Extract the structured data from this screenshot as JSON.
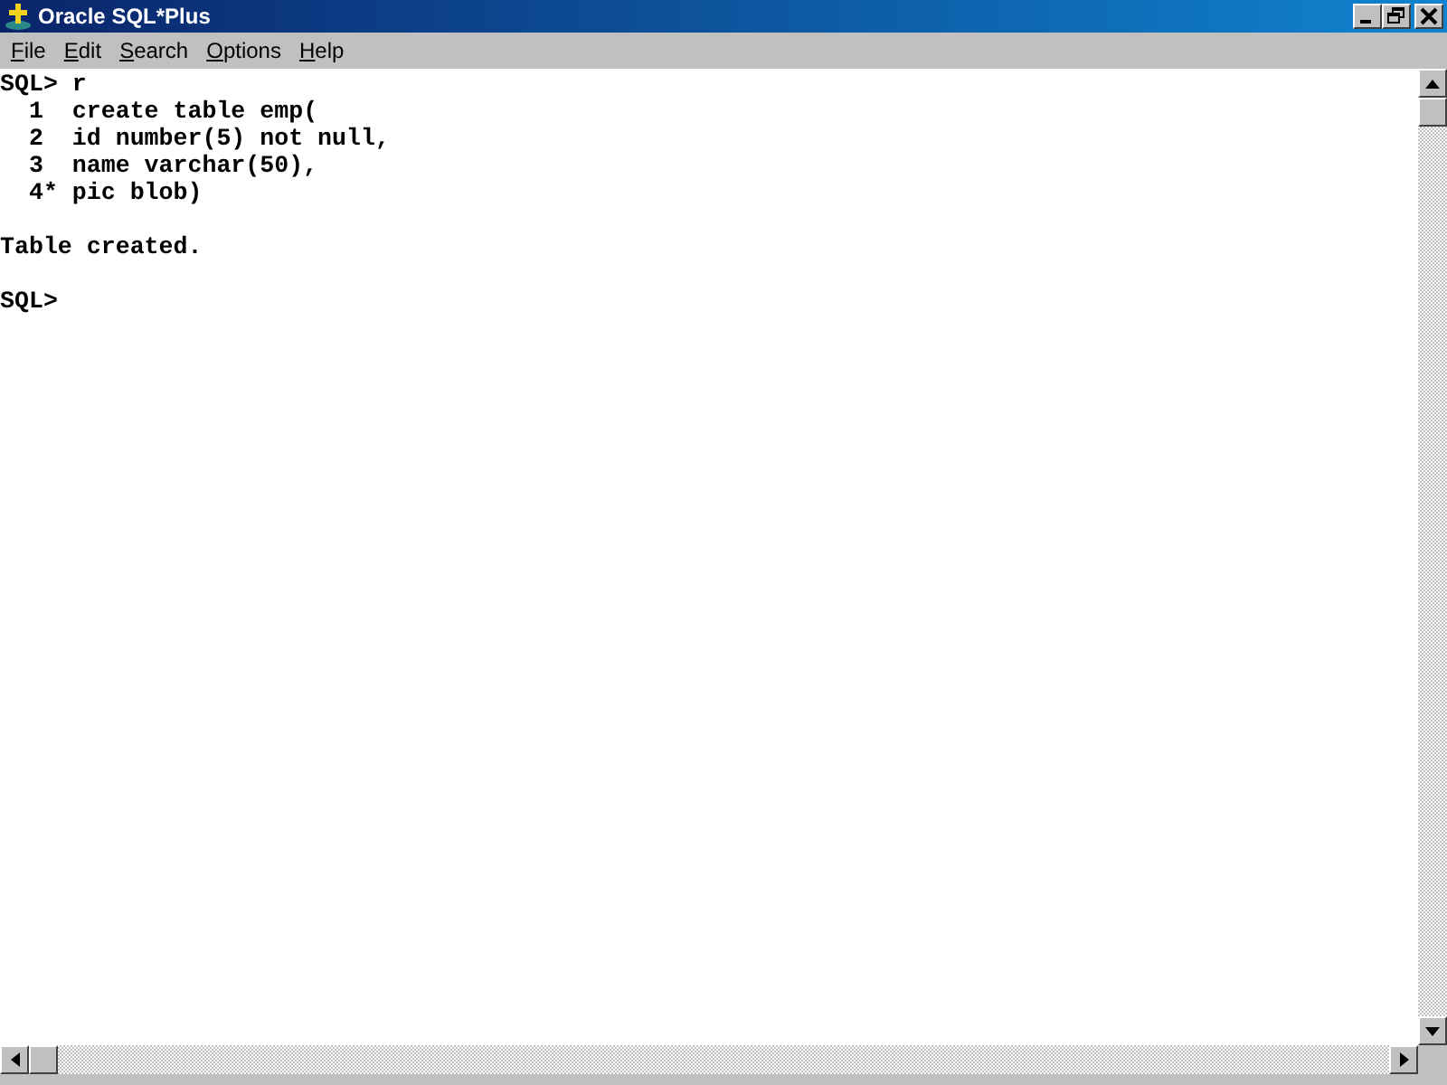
{
  "window": {
    "title": "Oracle SQL*Plus"
  },
  "menu": [
    "File",
    "Edit",
    "Search",
    "Options",
    "Help"
  ],
  "console": {
    "blocks": [
      [
        "SQL> r",
        "  1  create table emp(",
        "  2  id number(5) not null,",
        "  3  name varchar(50),",
        "  4* pic blob)"
      ],
      [
        "Table created."
      ],
      [
        "SQL>"
      ]
    ]
  }
}
